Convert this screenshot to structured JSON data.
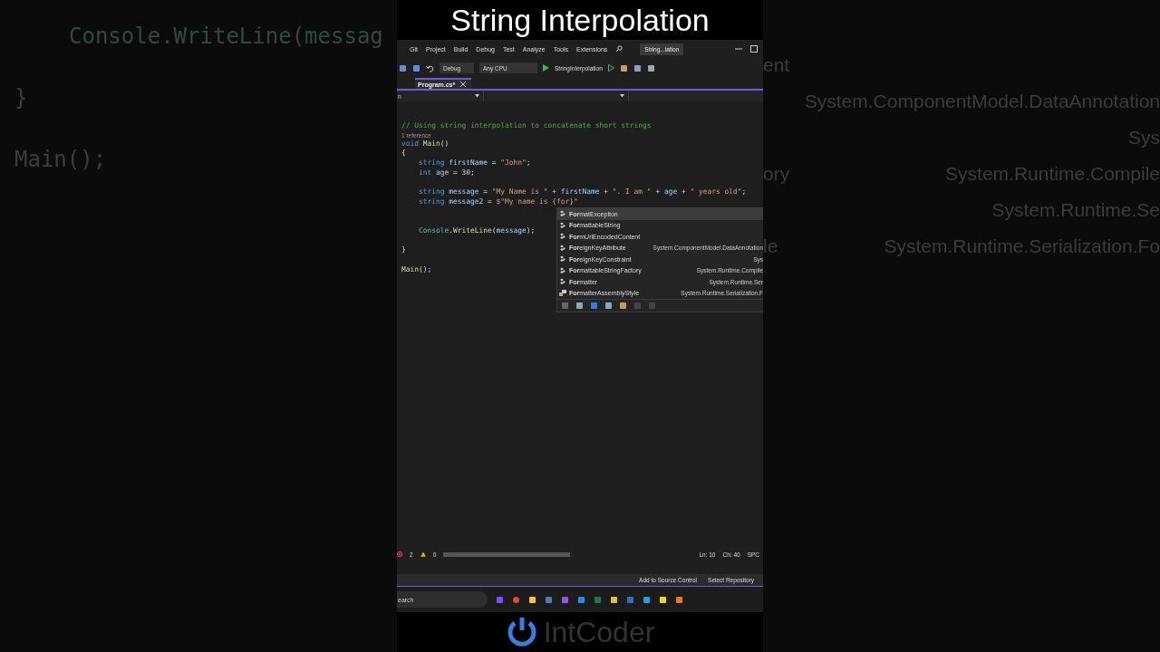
{
  "video_title": "String Interpolation",
  "backdrop_left": [
    "Console.WriteLine(messag",
    "}",
    "Main();"
  ],
  "backdrop_right": [
    {
      "left": "ent"
    },
    {
      "right": "System.ComponentModel.DataAnnotation"
    },
    {
      "right": "Sys"
    },
    {
      "left": "ory",
      "right": "System.Runtime.Compile"
    },
    {
      "right": "System.Runtime.Se"
    },
    {
      "left": "le",
      "right": "System.Runtime.Serialization.Fo"
    }
  ],
  "menu": [
    "Git",
    "Project",
    "Build",
    "Debug",
    "Test",
    "Analyze",
    "Tools",
    "Extensions"
  ],
  "title_badge": "String...lation",
  "toolbar": {
    "configuration": "Debug",
    "platform": "Any CPU",
    "startup": "StringInterpolation"
  },
  "tabs": [
    {
      "label": "Program.cs*",
      "selected": true
    }
  ],
  "nav_bar": {
    "scope": "n"
  },
  "code": [
    {
      "kind": "code",
      "tokens": [
        {
          "t": "// Using string interpolation to concatenate short strings",
          "kind": "comment"
        }
      ]
    },
    {
      "kind": "lens",
      "text": "1 reference"
    },
    {
      "kind": "code",
      "tokens": [
        {
          "t": "void ",
          "kind": "kw"
        },
        {
          "t": "Main",
          "kind": "fn"
        },
        {
          "t": "()",
          "kind": "plain"
        }
      ]
    },
    {
      "kind": "code",
      "tokens": [
        {
          "t": "{",
          "kind": "plain"
        }
      ]
    },
    {
      "kind": "code",
      "tokens": [
        {
          "t": "    string ",
          "kind": "kw"
        },
        {
          "t": "firstName",
          "kind": "var"
        },
        {
          "t": " = ",
          "kind": "plain"
        },
        {
          "t": "\"John\"",
          "kind": "str"
        },
        {
          "t": ";",
          "kind": "plain"
        }
      ]
    },
    {
      "kind": "code",
      "tokens": [
        {
          "t": "    int ",
          "kind": "kw"
        },
        {
          "t": "age",
          "kind": "var"
        },
        {
          "t": " = 30;",
          "kind": "plain"
        }
      ]
    },
    {
      "kind": "blank"
    },
    {
      "kind": "code",
      "tokens": [
        {
          "t": "    string ",
          "kind": "kw"
        },
        {
          "t": "message",
          "kind": "var"
        },
        {
          "t": " = ",
          "kind": "plain"
        },
        {
          "t": "\"My Name is \"",
          "kind": "str"
        },
        {
          "t": " + ",
          "kind": "plain"
        },
        {
          "t": "firstName",
          "kind": "var"
        },
        {
          "t": " + ",
          "kind": "plain"
        },
        {
          "t": "\". I am \"",
          "kind": "str"
        },
        {
          "t": " + ",
          "kind": "plain"
        },
        {
          "t": "age",
          "kind": "var"
        },
        {
          "t": " + ",
          "kind": "plain"
        },
        {
          "t": "\" years old\"",
          "kind": "str"
        },
        {
          "t": ";",
          "kind": "plain"
        }
      ]
    },
    {
      "kind": "code",
      "tokens": [
        {
          "t": "    string ",
          "kind": "kw"
        },
        {
          "t": "message2",
          "kind": "var"
        },
        {
          "t": " = ",
          "kind": "plain"
        },
        {
          "t": "$\"My name is {for}\"",
          "kind": "str"
        }
      ]
    },
    {
      "kind": "blank"
    },
    {
      "kind": "blank"
    },
    {
      "kind": "code",
      "tokens": [
        {
          "t": "    Console",
          "kind": "type"
        },
        {
          "t": ".",
          "kind": "plain"
        },
        {
          "t": "WriteLine",
          "kind": "fn"
        },
        {
          "t": "(",
          "kind": "plain"
        },
        {
          "t": "message",
          "kind": "var"
        },
        {
          "t": ");",
          "kind": "plain"
        }
      ]
    },
    {
      "kind": "blank"
    },
    {
      "kind": "code",
      "tokens": [
        {
          "t": "}",
          "kind": "plain"
        }
      ]
    },
    {
      "kind": "blank"
    },
    {
      "kind": "code",
      "tokens": [
        {
          "t": "Main",
          "kind": "fn"
        },
        {
          "t": "();",
          "kind": "plain"
        }
      ]
    }
  ],
  "completion": [
    {
      "label": "**For**matException",
      "selected": true,
      "kind": "class"
    },
    {
      "label": "**For**mattableString",
      "selected": false,
      "kind": "class"
    },
    {
      "label": "**For**mUrlEncodedContent",
      "selected": false,
      "kind": "class"
    },
    {
      "label": "**For**eignKeyAttribute",
      "namespace": "System.ComponentModel.DataAnnotation",
      "selected": false,
      "kind": "class"
    },
    {
      "label": "**For**eignKeyConstraint",
      "namespace": "Sys",
      "selected": false,
      "kind": "class"
    },
    {
      "label": "**For**mattableStringFactory",
      "namespace": "System.Runtime.Compile",
      "selected": false,
      "kind": "class"
    },
    {
      "label": "**For**matter",
      "namespace": "System.Runtime.Ser",
      "selected": false,
      "kind": "class"
    },
    {
      "label": "**For**matterAssemblyStyle",
      "namespace": "System.Runtime.Serialization.F",
      "selected": false,
      "kind": "enum"
    }
  ],
  "status_bar": {
    "errors": "2",
    "warnings": "0",
    "line": "Ln: 10",
    "column": "Ch: 40",
    "whitespace": "SPC"
  },
  "source_bar": {
    "add": "Add to Source Control",
    "repo": "Select Repository"
  },
  "taskbar": {
    "search": "earch"
  },
  "logo": "IntCoder"
}
